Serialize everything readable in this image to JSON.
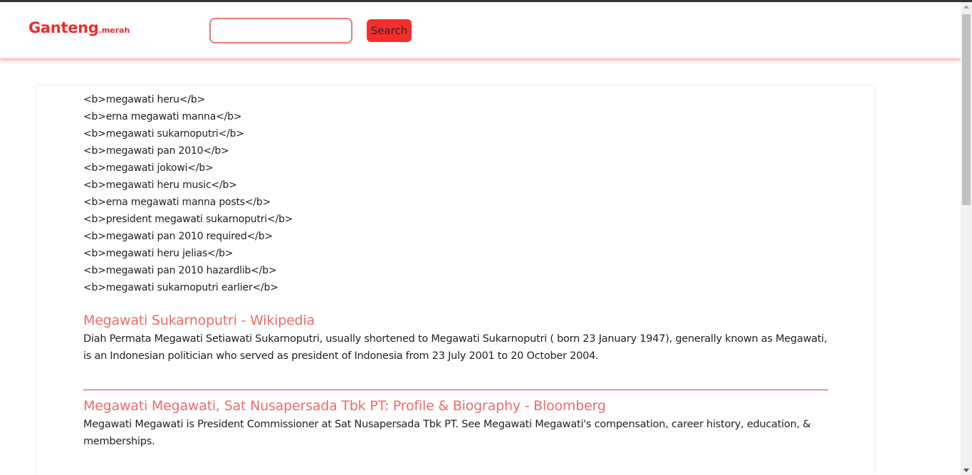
{
  "logo": {
    "main": "Ganteng",
    "sub": ".merah"
  },
  "search": {
    "value": "",
    "placeholder": "",
    "button_label": "Search"
  },
  "suggestions": [
    "<b>megawati heru</b>",
    "<b>erna megawati manna</b>",
    "<b>megawati sukarnoputri</b>",
    "<b>megawati pan 2010</b>",
    "<b>megawati jokowi</b>",
    "<b>megawati heru music</b>",
    "<b>erna megawati manna posts</b>",
    "<b>president megawati sukarnoputri</b>",
    "<b>megawati pan 2010 required</b>",
    "<b>megawati heru jelias</b>",
    "<b>megawati pan 2010 hazardlib</b>",
    "<b>megawati sukarnoputri earlier</b>"
  ],
  "results": [
    {
      "title": "Megawati Sukarnoputri - Wikipedia",
      "snippet": "Diah Permata Megawati Setiawati Sukarnoputri, usually shortened to Megawati Sukarnoputri ( born 23 January 1947), generally known as Megawati, is an Indonesian politician who served as president of Indonesia from 23 July 2001 to 20 October 2004."
    },
    {
      "title": "Megawati Megawati, Sat Nusapersada Tbk PT: Profile & Biography - Bloomberg",
      "snippet": "Megawati Megawati is President Commissioner at Sat Nusapersada Tbk PT. See Megawati Megawati's compensation, career history, education, & memberships."
    }
  ],
  "colors": {
    "brand": "#ef2b2b",
    "button": "#f72d2d",
    "link": "#f06a6a",
    "divider": "#e0336b"
  }
}
